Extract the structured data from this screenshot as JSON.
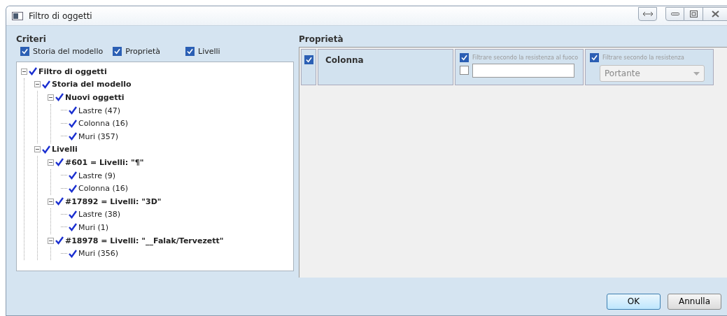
{
  "window": {
    "title": "Filtro di oggetti"
  },
  "criteria": {
    "title": "Criteri",
    "options": [
      {
        "label": "Storia del modello",
        "checked": true
      },
      {
        "label": "Proprietà",
        "checked": true
      },
      {
        "label": "Livelli",
        "checked": true
      }
    ]
  },
  "tree": [
    {
      "label": "Filtro di oggetti",
      "checked": true,
      "expanded": true,
      "children": [
        {
          "label": "Storia del modello",
          "checked": true,
          "expanded": true,
          "children": [
            {
              "label": "Nuovi oggetti",
              "checked": true,
              "expanded": true,
              "children": [
                {
                  "label": "Lastre (47)",
                  "checked": true
                },
                {
                  "label": "Colonna (16)",
                  "checked": true
                },
                {
                  "label": "Muri (357)",
                  "checked": true
                }
              ]
            }
          ]
        },
        {
          "label": "Livelli",
          "checked": true,
          "expanded": true,
          "children": [
            {
              "label": "#601 = Livelli: \"¶\"",
              "checked": true,
              "expanded": true,
              "children": [
                {
                  "label": "Lastre (9)",
                  "checked": true
                },
                {
                  "label": "Colonna (16)",
                  "checked": true
                }
              ]
            },
            {
              "label": "#17892 = Livelli: \"3D\"",
              "checked": true,
              "expanded": true,
              "children": [
                {
                  "label": "Lastre (38)",
                  "checked": true
                },
                {
                  "label": "Muri (1)",
                  "checked": true
                }
              ]
            },
            {
              "label": "#18978 = Livelli: \"__Falak/Tervezett\"",
              "checked": true,
              "expanded": true,
              "children": [
                {
                  "label": "Muri (356)",
                  "checked": true
                }
              ]
            }
          ]
        }
      ]
    }
  ],
  "properties": {
    "title": "Proprietà",
    "rows": [
      {
        "checked": true,
        "name": "Colonna",
        "fire_filter": {
          "label": "Filtrare secondo la resistenza al fuoco",
          "checked": true,
          "value_checked": false
        },
        "resistance_filter": {
          "label": "Filtrare secondo la resistenza",
          "checked": true,
          "value": "Portante"
        }
      }
    ]
  },
  "buttons": [
    {
      "label": "OK",
      "default": true
    },
    {
      "label": "Annulla",
      "default": false
    }
  ]
}
